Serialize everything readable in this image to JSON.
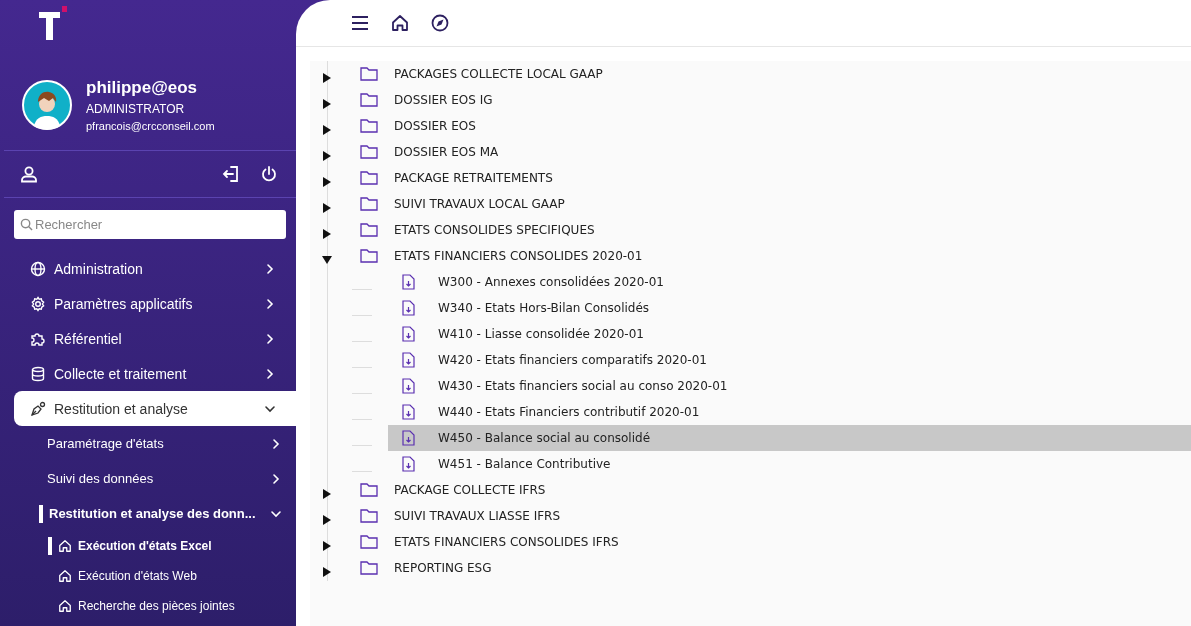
{
  "user": {
    "name": "philippe@eos",
    "role": "ADMINISTRATOR",
    "email": "pfrancois@crcconseil.com"
  },
  "search": {
    "placeholder": "Rechercher"
  },
  "nav": [
    {
      "label": "Administration",
      "expanded": false,
      "selected": false
    },
    {
      "label": "Paramètres applicatifs",
      "expanded": false,
      "selected": false
    },
    {
      "label": "Référentiel",
      "expanded": false,
      "selected": false
    },
    {
      "label": "Collecte et traitement",
      "expanded": false,
      "selected": false
    },
    {
      "label": "Restitution et analyse",
      "expanded": true,
      "selected": true,
      "children": [
        {
          "label": "Paramétrage d'états",
          "expanded": false,
          "selected": false
        },
        {
          "label": "Suivi des données",
          "expanded": false,
          "selected": false
        },
        {
          "label": "Restitution et analyse des donn...",
          "expanded": true,
          "selected": true,
          "children": [
            {
              "label": "Exécution d'états Excel",
              "selected": true
            },
            {
              "label": "Exécution d'états Web",
              "selected": false
            },
            {
              "label": "Recherche des pièces jointes",
              "selected": false
            }
          ]
        }
      ]
    }
  ],
  "tree": [
    {
      "kind": "folder",
      "label": "PACKAGES COLLECTE LOCAL GAAP",
      "expanded": false,
      "selected": false
    },
    {
      "kind": "folder",
      "label": "DOSSIER EOS IG",
      "expanded": false,
      "selected": false
    },
    {
      "kind": "folder",
      "label": "DOSSIER EOS",
      "expanded": false,
      "selected": false
    },
    {
      "kind": "folder",
      "label": "DOSSIER EOS MA",
      "expanded": false,
      "selected": false
    },
    {
      "kind": "folder",
      "label": "PACKAGE RETRAITEMENTS",
      "expanded": false,
      "selected": false
    },
    {
      "kind": "folder",
      "label": "SUIVI TRAVAUX LOCAL GAAP",
      "expanded": false,
      "selected": false
    },
    {
      "kind": "folder",
      "label": "ETATS CONSOLIDES SPECIFIQUES",
      "expanded": false,
      "selected": false
    },
    {
      "kind": "folder",
      "label": "ETATS FINANCIERS CONSOLIDES 2020-01",
      "expanded": true,
      "selected": false,
      "children": [
        {
          "kind": "file",
          "label": "W300 - Annexes consolidées 2020-01",
          "selected": false
        },
        {
          "kind": "file",
          "label": "W340 - Etats Hors-Bilan Consolidés",
          "selected": false
        },
        {
          "kind": "file",
          "label": "W410 - Liasse consolidée 2020-01",
          "selected": false
        },
        {
          "kind": "file",
          "label": "W420 - Etats financiers comparatifs 2020-01",
          "selected": false
        },
        {
          "kind": "file",
          "label": "W430 - Etats financiers social au conso 2020-01",
          "selected": false
        },
        {
          "kind": "file",
          "label": "W440 - Etats Financiers contributif 2020-01",
          "selected": false
        },
        {
          "kind": "file",
          "label": "W450 - Balance social au consolidé",
          "selected": true
        },
        {
          "kind": "file",
          "label": "W451 - Balance Contributive",
          "selected": false
        }
      ]
    },
    {
      "kind": "folder",
      "label": "PACKAGE COLLECTE IFRS",
      "expanded": false,
      "selected": false
    },
    {
      "kind": "folder",
      "label": "SUIVI TRAVAUX LIASSE IFRS",
      "expanded": false,
      "selected": false
    },
    {
      "kind": "folder",
      "label": "ETATS FINANCIERS CONSOLIDES IFRS",
      "expanded": false,
      "selected": false
    },
    {
      "kind": "folder",
      "label": "REPORTING ESG",
      "expanded": false,
      "selected": false
    }
  ]
}
